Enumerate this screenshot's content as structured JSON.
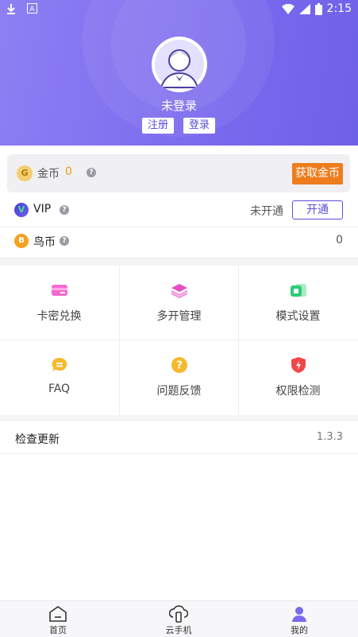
{
  "status_bar": {
    "time": "2:15"
  },
  "profile": {
    "username": "未登录",
    "register_label": "注册",
    "login_label": "登录"
  },
  "coins": {
    "label": "金币",
    "value": "0",
    "get_button": "获取金币",
    "icon_letter": "G"
  },
  "vip": {
    "label": "VIP",
    "status": "未开通",
    "open_button": "开通",
    "icon_letter": "V"
  },
  "bird_coin": {
    "label": "鸟币",
    "value": "0",
    "icon_letter": "B"
  },
  "grid": {
    "items": [
      {
        "label": "卡密兑换",
        "icon": "card-icon"
      },
      {
        "label": "多开管理",
        "icon": "layers-icon"
      },
      {
        "label": "模式设置",
        "icon": "mode-icon"
      },
      {
        "label": "FAQ",
        "icon": "faq-icon"
      },
      {
        "label": "问题反馈",
        "icon": "feedback-icon"
      },
      {
        "label": "权限检测",
        "icon": "shield-icon"
      }
    ]
  },
  "update": {
    "label": "检查更新",
    "version": "1.3.3"
  },
  "tabbar": {
    "tabs": [
      {
        "label": "首页",
        "icon": "home-icon"
      },
      {
        "label": "云手机",
        "icon": "cloud-phone-icon"
      },
      {
        "label": "我的",
        "icon": "profile-icon"
      }
    ],
    "active": "我的"
  },
  "colors": {
    "accent": "#7a6aee",
    "orange": "#ee7d1e",
    "coin": "#f39a1f"
  }
}
